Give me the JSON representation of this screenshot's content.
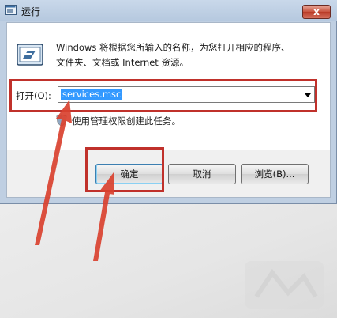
{
  "window": {
    "title": "运行",
    "close_glyph": "x"
  },
  "dialog": {
    "description_line1": "Windows 将根据您所输入的名称，为您打开相应的程序、",
    "description_line2": "文件夹、文档或 Internet 资源。",
    "open_label": "打开(O):",
    "open_value": "services.msc",
    "admin_note": "使用管理权限创建此任务。"
  },
  "buttons": {
    "ok": "确定",
    "cancel": "取消",
    "browse": "浏览(B)..."
  },
  "icons": {
    "title": "run-icon",
    "app": "run-app-icon",
    "shield": "uac-shield-icon",
    "dropdown": "chevron-down-icon"
  },
  "colors": {
    "highlight": "#c0312b",
    "selection": "#3399ff"
  }
}
